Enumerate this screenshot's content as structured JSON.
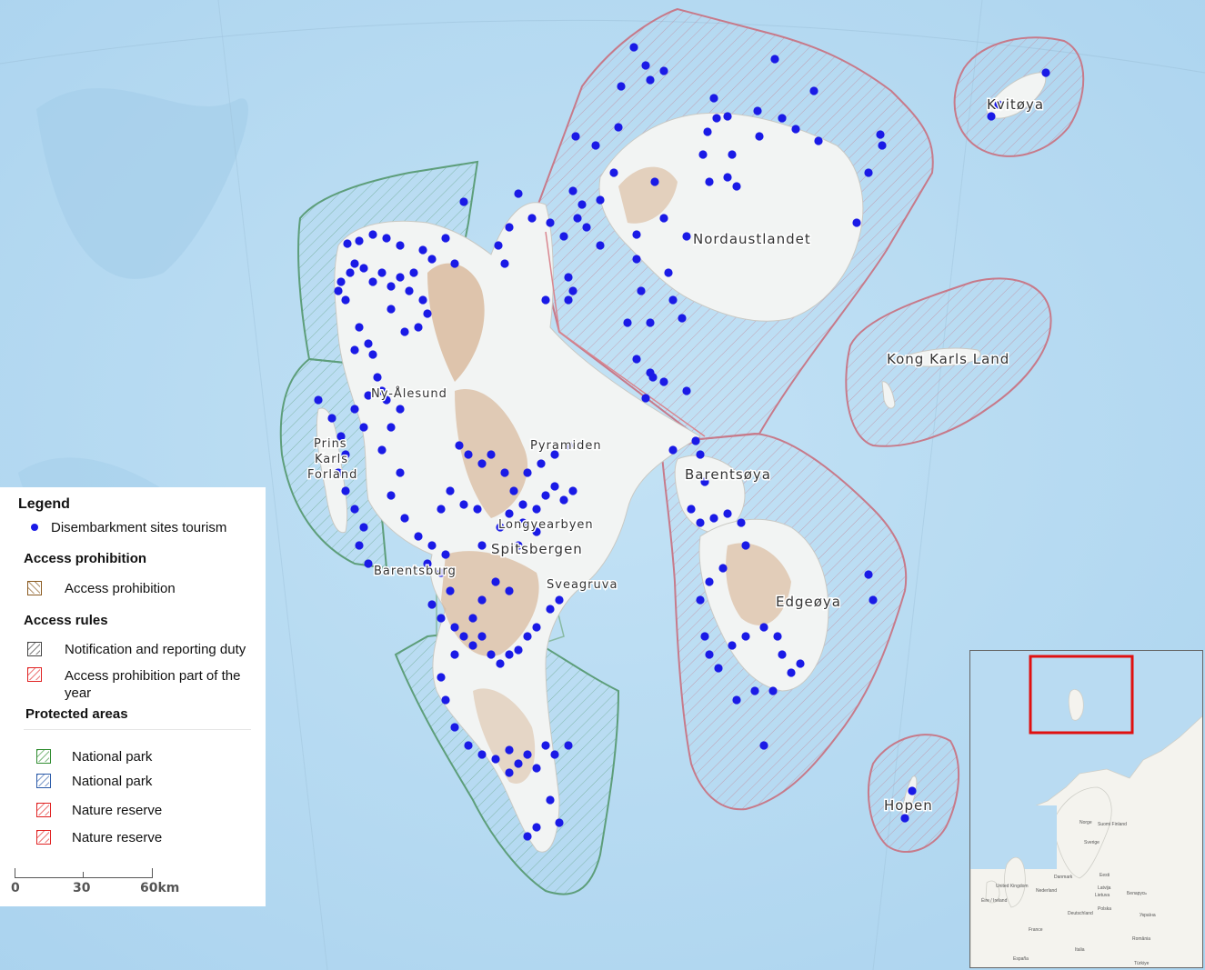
{
  "colors": {
    "sea": "#b9dbf2",
    "sea_deep": "#a8cfee",
    "land": "#f2f4f3",
    "terrain": "#d8b89a",
    "np_green": "#5d9e7a",
    "np_fill": "rgba(120,170,150,0.18)",
    "nr_red": "#c77a8a",
    "nr_fill": "rgba(200,140,160,0.10)",
    "site": "#1a1ae6",
    "inset_frame": "#e01010"
  },
  "places": {
    "kvitoya": "Kvitøya",
    "nordaustlandet": "Nordaustlandet",
    "kong_karls_land": "Kong Karls Land",
    "ny_alesund": "Ny-Ålesund",
    "pyramiden": "Pyramiden",
    "prins_karls_forland_1": "Prins",
    "prins_karls_forland_2": "Karls",
    "prins_karls_forland_3": "Forland",
    "barentsoya": "Barentsøya",
    "longyearbyen": "Longyearbyen",
    "spitsbergen": "Spitsbergen",
    "barentsburg": "Barentsburg",
    "sveagruva": "Sveagruva",
    "edgeoya": "Edgeøya",
    "hopen": "Hopen"
  },
  "legend": {
    "title": "Legend",
    "sites_label": "Disembarkment sites tourism",
    "access_prohibition_header": "Access prohibition",
    "access_prohibition_label": "Access prohibition",
    "access_rules_header": "Access rules",
    "notification_label": "Notification and reporting duty",
    "prohibition_part_year_line1": "Access prohibition part of the",
    "prohibition_part_year_line2": "year",
    "protected_header": "Protected areas",
    "national_park_green": "National park",
    "national_park_blue": "National park",
    "nature_reserve_1": "Nature reserve",
    "nature_reserve_2": "Nature reserve"
  },
  "scale_bar": {
    "t0": "0",
    "t1": "30",
    "t2": "60km"
  },
  "inset": {
    "countries": [
      "Norge",
      "Suomi Finland",
      "Sverige",
      "Eesti",
      "Latvija",
      "Lietuva",
      "Danmark",
      "United Kingdom",
      "Éire / Ireland",
      "Nederland",
      "Deutschland",
      "Polska",
      "Беларусь",
      "Україна",
      "France",
      "España",
      "Italia",
      "Türkiye",
      "România"
    ]
  }
}
